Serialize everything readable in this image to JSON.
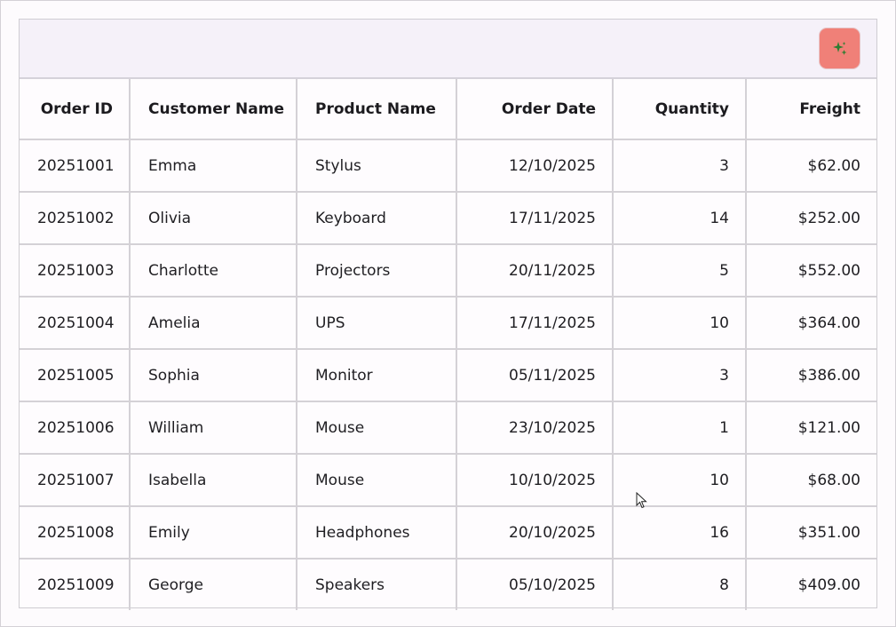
{
  "toolbar": {
    "ai_icon": "sparkle-icon",
    "colors": {
      "button_bg": "#f08078",
      "icon_color": "#2e7d32"
    }
  },
  "grid": {
    "columns": [
      {
        "key": "order_id",
        "label": "Order ID",
        "align": "right"
      },
      {
        "key": "customer_name",
        "label": "Customer Name",
        "align": "left"
      },
      {
        "key": "product_name",
        "label": "Product Name",
        "align": "left"
      },
      {
        "key": "order_date",
        "label": "Order Date",
        "align": "right"
      },
      {
        "key": "quantity",
        "label": "Quantity",
        "align": "right"
      },
      {
        "key": "freight",
        "label": "Freight",
        "align": "right"
      }
    ],
    "rows": [
      [
        "20251001",
        "Emma",
        "Stylus",
        "12/10/2025",
        "3",
        "$62.00"
      ],
      [
        "20251002",
        "Olivia",
        "Keyboard",
        "17/11/2025",
        "14",
        "$252.00"
      ],
      [
        "20251003",
        "Charlotte",
        "Projectors",
        "20/11/2025",
        "5",
        "$552.00"
      ],
      [
        "20251004",
        "Amelia",
        "UPS",
        "17/11/2025",
        "10",
        "$364.00"
      ],
      [
        "20251005",
        "Sophia",
        "Monitor",
        "05/11/2025",
        "3",
        "$386.00"
      ],
      [
        "20251006",
        "William",
        "Mouse",
        "23/10/2025",
        "1",
        "$121.00"
      ],
      [
        "20251007",
        "Isabella",
        "Mouse",
        "10/10/2025",
        "10",
        "$68.00"
      ],
      [
        "20251008",
        "Emily",
        "Headphones",
        "20/10/2025",
        "16",
        "$351.00"
      ],
      [
        "20251009",
        "George",
        "Speakers",
        "05/10/2025",
        "8",
        "$409.00"
      ]
    ]
  }
}
